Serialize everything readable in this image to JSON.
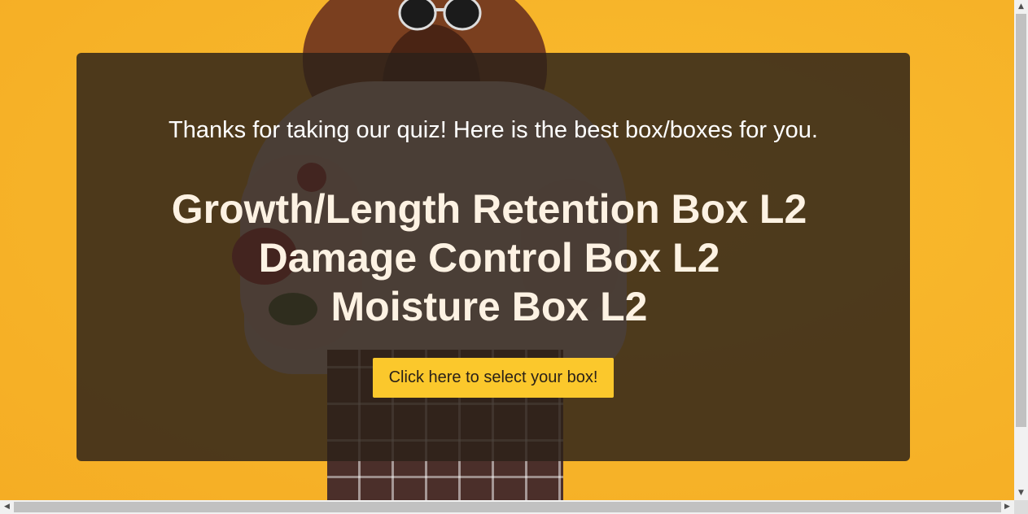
{
  "page": {
    "thanks_message": "Thanks for taking our quiz! Here is the best box/boxes for you.",
    "results": [
      "Growth/Length Retention Box L2",
      "Damage Control Box L2",
      "Moisture Box L2"
    ],
    "select_button_label": "Click here to select your box!"
  },
  "colors": {
    "background": "#f7b52a",
    "overlay": "#2c2119",
    "button": "#fbc82c"
  },
  "icons": {
    "scroll_up": "▲",
    "scroll_down": "▼",
    "scroll_left": "◀",
    "scroll_right": "▶"
  }
}
